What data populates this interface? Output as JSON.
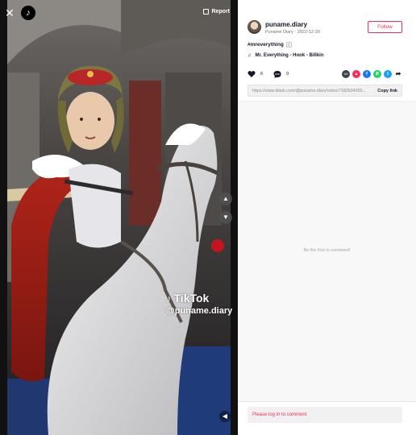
{
  "header": {
    "close_icon": "close-icon",
    "logo_icon": "tiktok-logo-icon",
    "report_label": "Report",
    "report_icon": "flag-icon"
  },
  "player": {
    "prev_icon": "chevron-up-icon",
    "next_icon": "chevron-down-icon",
    "mute_icon": "speaker-icon",
    "watermark_brand": "TikTok",
    "watermark_handle": "@puname.diary"
  },
  "author": {
    "handle": "puname.diary",
    "display_name": "Puname Diary",
    "separator": "·",
    "date": "2022-12-30",
    "follow_label": "Follow"
  },
  "post": {
    "hashtag": "#mreverything",
    "translate_icon": "translate-icon",
    "music_icon": "music-note-icon",
    "music_title": "Mr. Everything - Hook - Billkin"
  },
  "actions": {
    "like_icon": "heart-icon",
    "like_count": "6",
    "comment_icon": "comment-icon",
    "comment_count": "0"
  },
  "share": [
    {
      "icon": "embed-icon",
      "glyph": "</>",
      "color": "#3e4450"
    },
    {
      "icon": "direct-message-icon",
      "glyph": "▲",
      "color": "#fe2c55"
    },
    {
      "icon": "facebook-icon",
      "glyph": "f",
      "color": "#1877f2"
    },
    {
      "icon": "whatsapp-icon",
      "glyph": "✆",
      "color": "#25d366"
    },
    {
      "icon": "twitter-icon",
      "glyph": "t",
      "color": "#1da1f2"
    },
    {
      "icon": "share-arrow-icon",
      "glyph": "➦",
      "color": "#161823"
    }
  ],
  "link": {
    "url": "https://www.tiktok.com/@puname.diary/video/7182634055...",
    "copy_label": "Copy link"
  },
  "comments": {
    "empty_text": "Be the first to comment!",
    "login_prompt": "Please log in to comment"
  },
  "colors": {
    "accent": "#fe2c55",
    "text": "#161823",
    "muted": "#8a8b91"
  }
}
